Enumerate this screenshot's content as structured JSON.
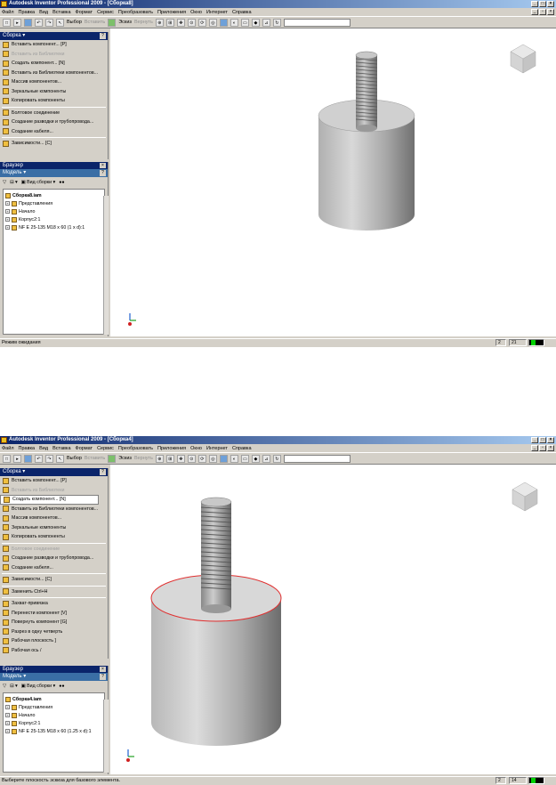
{
  "windows": [
    {
      "title": "Autodesk Inventor Professional 2009 - [Сборка8]",
      "menu": [
        "Файл",
        "Правка",
        "Вид",
        "Вставка",
        "Формат",
        "Сервис",
        "Преобразовать",
        "Приложения",
        "Окно",
        "Интернет",
        "Справка"
      ],
      "toolbar": {
        "select_label": "Выбор",
        "insert_label": "Вставить",
        "sketch_label": "Эскиз",
        "return_label": "Вернуть"
      },
      "panel": {
        "title": "Сборка",
        "items": [
          {
            "label": "Вставить компонент...   [P]",
            "dim": false
          },
          {
            "label": "Вставить из Библиотеки",
            "dim": true
          },
          {
            "label": "Создать компонент...   [N]",
            "dim": false
          },
          {
            "label": "Вставить из Библиотеки компонентов...",
            "dim": false
          },
          {
            "label": "Массив компонентов...",
            "dim": false
          },
          {
            "label": "Зеркальные компоненты",
            "dim": false
          },
          {
            "label": "Копировать компоненты",
            "dim": false
          },
          {
            "sep": true
          },
          {
            "label": "Болтовое соединение",
            "dim": false
          },
          {
            "label": "Создание разводки и трубопровода...",
            "dim": false
          },
          {
            "label": "Создание кабеля...",
            "dim": false
          },
          {
            "sep": true
          },
          {
            "label": "Зависимости...   [C]",
            "dim": false
          }
        ]
      },
      "browser": {
        "title": "Браузер",
        "model": "Модель",
        "view_label": "Вид сборки",
        "tree": [
          {
            "label": "Сборка8.iam",
            "root": true
          },
          {
            "label": "Представления",
            "root": false
          },
          {
            "label": "Начало",
            "root": false
          },
          {
            "label": "Корпус2:1",
            "root": false
          },
          {
            "label": "NF E 25-135 M18 x 60 (1 x d):1",
            "root": false
          }
        ]
      },
      "status": "Режим ожидания",
      "counts": [
        "2",
        "21"
      ]
    },
    {
      "title": "Autodesk Inventor Professional 2009 - [Сборка4]",
      "menu": [
        "Файл",
        "Правка",
        "Вид",
        "Вставка",
        "Формат",
        "Сервис",
        "Преобразовать",
        "Приложения",
        "Окно",
        "Интернет",
        "Справка"
      ],
      "toolbar": {
        "select_label": "Выбор",
        "insert_label": "Вставить",
        "sketch_label": "Эскиз",
        "return_label": "Вернуть"
      },
      "panel": {
        "title": "Сборка",
        "items": [
          {
            "label": "Вставить компонент...   [P]",
            "dim": false
          },
          {
            "label": "Вставить из Библиотеки",
            "dim": true
          },
          {
            "label": "Создать компонент...   [N]",
            "dim": false,
            "sel": true
          },
          {
            "label": "Вставить из Библиотеки компонентов...",
            "dim": false
          },
          {
            "label": "Массив компонентов...",
            "dim": false
          },
          {
            "label": "Зеркальные компоненты",
            "dim": false
          },
          {
            "label": "Копировать компоненты",
            "dim": false
          },
          {
            "sep": true
          },
          {
            "label": "Болтовое соединение",
            "dim": true
          },
          {
            "label": "Создание разводки и трубопровода...",
            "dim": false
          },
          {
            "label": "Создание кабеля...",
            "dim": false
          },
          {
            "sep": true
          },
          {
            "label": "Зависимости...   [C]",
            "dim": false
          },
          {
            "sep": true
          },
          {
            "label": "Заменить   Ctrl+H",
            "dim": false
          },
          {
            "sep": true
          },
          {
            "label": "Захват-привязка",
            "dim": false
          },
          {
            "label": "Перенести компонент   [V]",
            "dim": false
          },
          {
            "label": "Повернуть компонент   [G]",
            "dim": false
          },
          {
            "label": "Разрез в одну четверть",
            "dim": false
          },
          {
            "label": "Рабочая плоскость   ]",
            "dim": false
          },
          {
            "label": "Рабочая ось   /",
            "dim": false
          }
        ]
      },
      "browser": {
        "title": "Браузер",
        "model": "Модель",
        "view_label": "Вид сборки",
        "tree": [
          {
            "label": "Сборка4.iam",
            "root": true
          },
          {
            "label": "Представления",
            "root": false
          },
          {
            "label": "Начало",
            "root": false
          },
          {
            "label": "Корпус2:1",
            "root": false
          },
          {
            "label": "NF E 25-135 M18 x 60 (1.25 x d):1",
            "root": false
          }
        ]
      },
      "status": "Выберите плоскость эскиза для базового элемента.",
      "counts": [
        "2",
        "14"
      ]
    }
  ],
  "colors": {
    "title_start": "#0a246a",
    "title_end": "#a6caf0",
    "selection_edge": "#e03030"
  }
}
